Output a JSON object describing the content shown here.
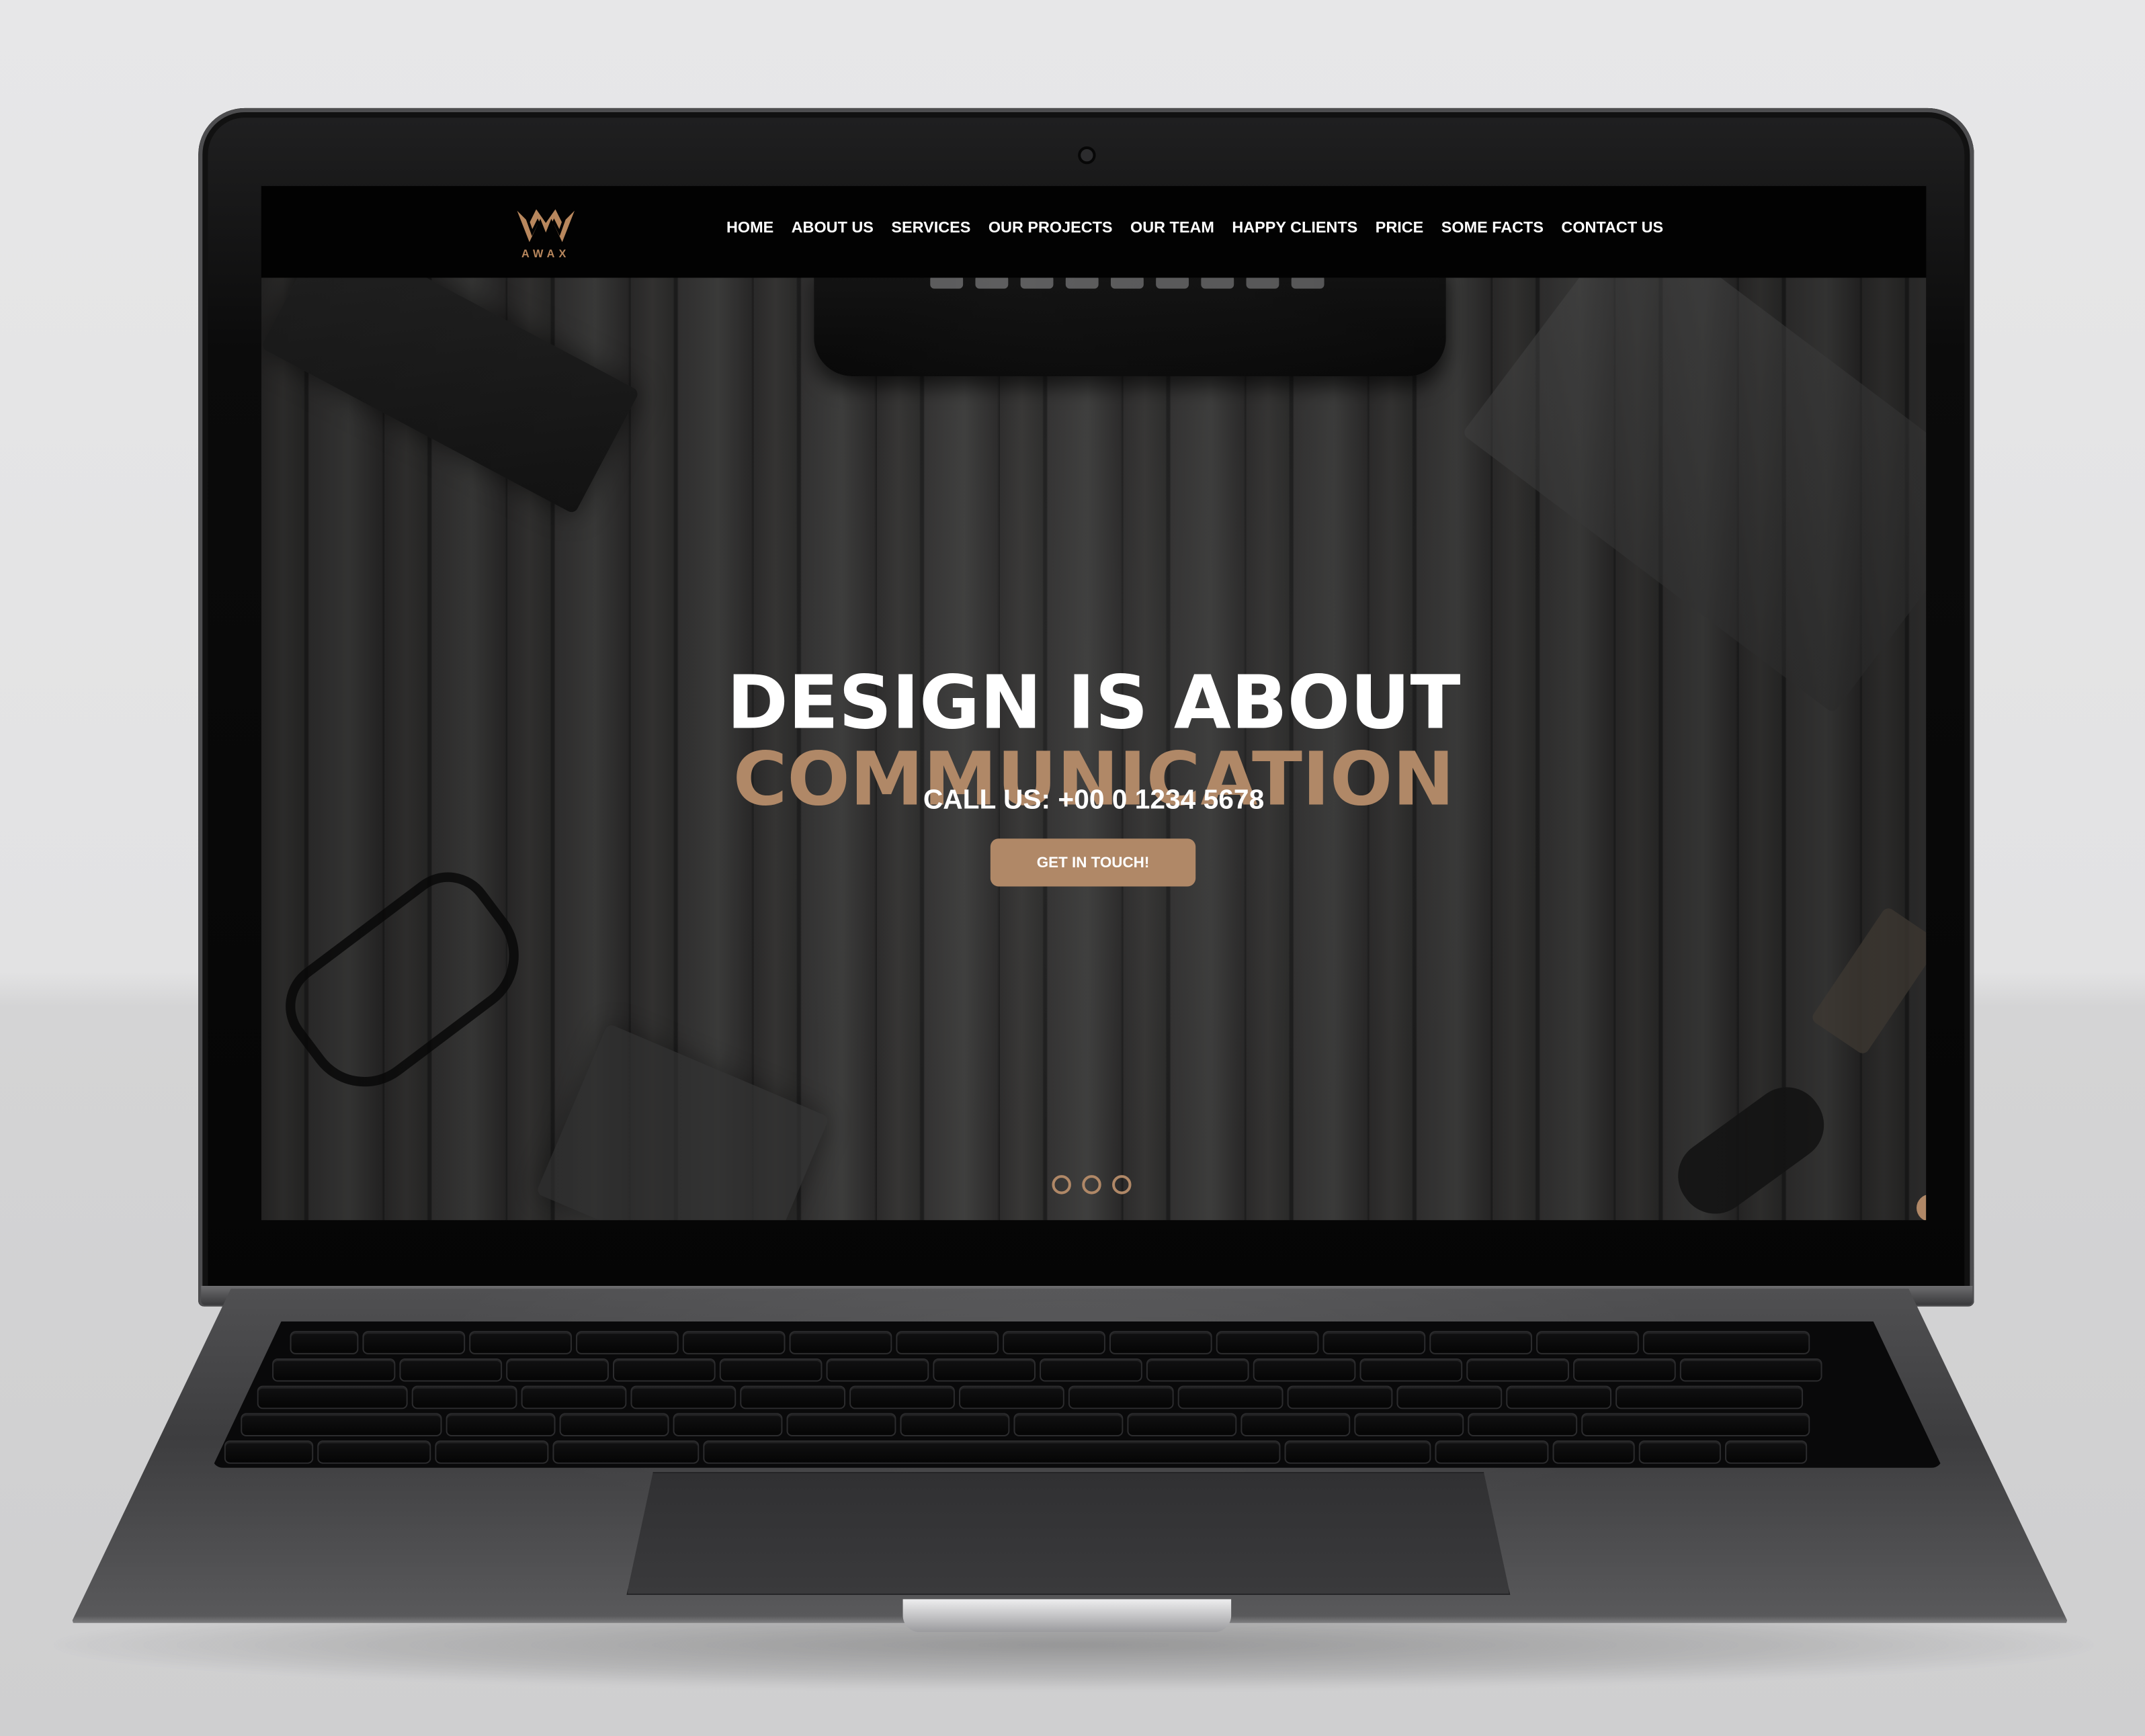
{
  "site": {
    "brand_name": "AWAX",
    "accent_color": "#b8875d",
    "navigation": [
      {
        "label": "HOME"
      },
      {
        "label": "ABOUT US"
      },
      {
        "label": "SERVICES"
      },
      {
        "label": "OUR PROJECTS"
      },
      {
        "label": "OUR TEAM"
      },
      {
        "label": "HAPPY CLIENTS"
      },
      {
        "label": "PRICE"
      },
      {
        "label": "SOME FACTS"
      },
      {
        "label": "CONTACT US"
      }
    ]
  },
  "hero": {
    "title_line_1": "DESIGN IS ABOUT",
    "title_line_2": "COMMUNICATION",
    "phone_text": "CALL US: +00 0 1234 5678",
    "button_label": "GET IN TOUCH!",
    "carousel_dots": 3
  },
  "icons": {
    "logo": "awax-crown-logo-icon",
    "camera": "webcam-dot-icon"
  }
}
